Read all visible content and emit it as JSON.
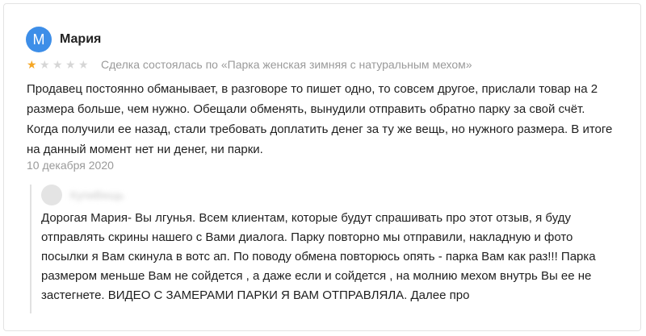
{
  "review": {
    "avatar_letter": "М",
    "author": "Мария",
    "rating": 1,
    "rating_max": 5,
    "deal_text": "Сделка состоялась по «Парка женская зимняя с натуральным мехом»",
    "text": "Продавец постоянно обманывает, в разговоре то пишет одно, то совсем другое, прислали товар на 2 размера больше, чем нужно. Обещали обменять, вынудили отправить обратно парку за свой счёт. Когда получили ее назад, стали требовать доплатить денег за ту же вещь, но нужного размера. В итоге на данный момент нет ни денег, ни парки.",
    "date": "10 декабря 2020"
  },
  "reply": {
    "author": "КупиВещь",
    "text": "Дорогая Мария- Вы лгунья. Всем клиентам, которые будут спрашивать про этот отзыв, я буду отправлять скрины нашего с Вами диалога. Парку повторно мы отправили, накладную и фото посылки я Вам скинула в вотс ап. По поводу обмена повторюсь опять - парка Вам как раз!!! Парка размером меньше Вам не сойдется , а даже если и сойдется , на молнию мехом внутрь Вы ее не застегнете. ВИДЕО С ЗАМЕРАМИ ПАРКИ Я ВАМ ОТПРАВЛЯЛА. Далее про"
  },
  "colors": {
    "avatar_bg": "#3d8ee8",
    "star_on": "#f5a623",
    "star_off": "#d6d6d6",
    "muted_text": "#9a9a9a"
  }
}
